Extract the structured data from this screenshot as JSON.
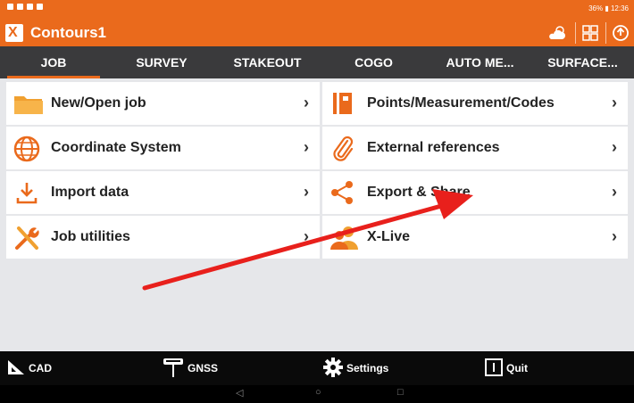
{
  "statusbar": {
    "clock": "36% ▮ 12:36"
  },
  "app": {
    "title": "Contours1"
  },
  "tabs": [
    {
      "label": "JOB",
      "active": true
    },
    {
      "label": "SURVEY"
    },
    {
      "label": "STAKEOUT"
    },
    {
      "label": "COGO"
    },
    {
      "label": "AUTO ME..."
    },
    {
      "label": "SURFACE..."
    }
  ],
  "menu": {
    "left": [
      {
        "label": "New/Open job",
        "icon": "folder-icon"
      },
      {
        "label": "Coordinate System",
        "icon": "globe-icon"
      },
      {
        "label": "Import data",
        "icon": "download-icon"
      },
      {
        "label": "Job utilities",
        "icon": "tools-icon"
      }
    ],
    "right": [
      {
        "label": "Points/Measurement/Codes",
        "icon": "points-icon"
      },
      {
        "label": "External references",
        "icon": "paperclip-icon"
      },
      {
        "label": "Export & Share",
        "icon": "share-icon"
      },
      {
        "label": "X-Live",
        "icon": "users-icon"
      }
    ],
    "chevron": "›"
  },
  "bottombar": {
    "cad": "CAD",
    "gnss": "GNSS",
    "settings": "Settings",
    "quit": "Quit"
  },
  "colors": {
    "accent": "#ea6a1c",
    "tabbar": "#3a3a3c",
    "arrow": "#e8201c"
  }
}
